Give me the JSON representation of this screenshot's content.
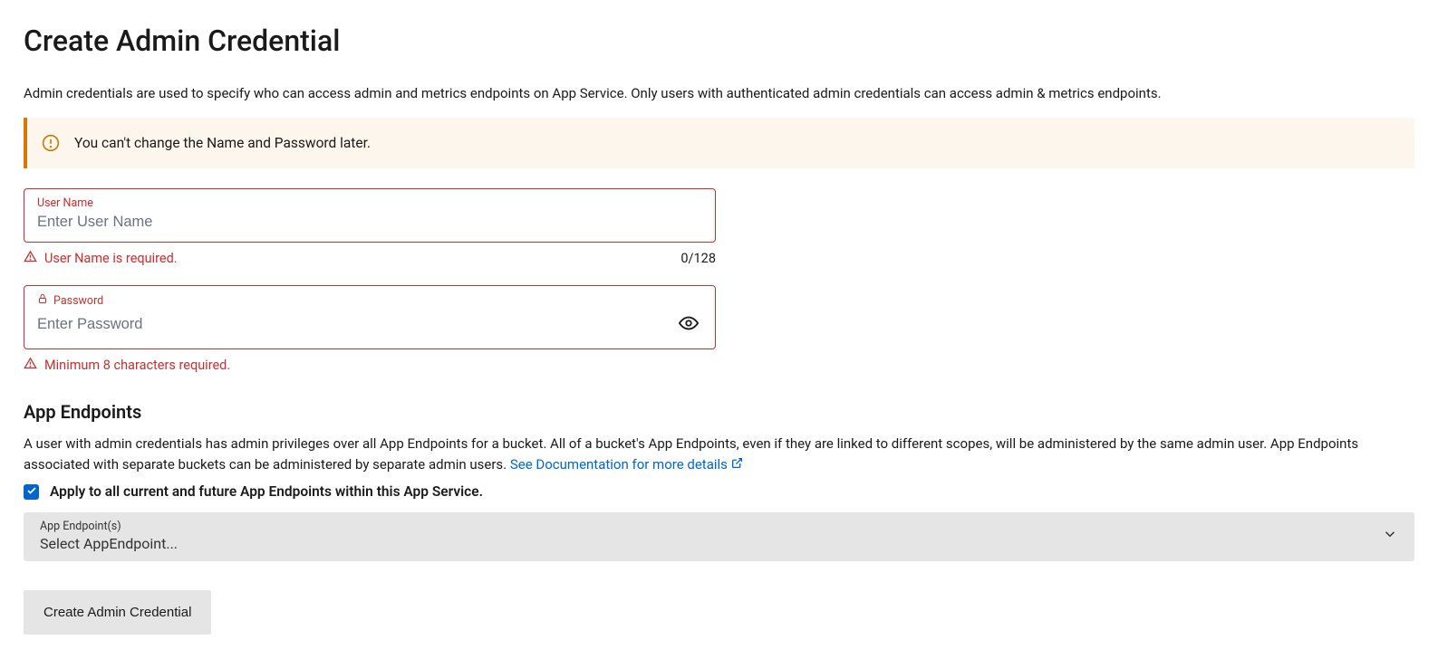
{
  "title": "Create Admin Credential",
  "intro": "Admin credentials are used to specify who can access admin and metrics endpoints on App Service. Only users with authenticated admin credentials can access admin & metrics endpoints.",
  "alert": {
    "text": "You can't change the Name and Password later."
  },
  "username": {
    "label": "User Name",
    "placeholder": "Enter User Name",
    "error": "User Name is required.",
    "counter": "0/128"
  },
  "password": {
    "label": "Password",
    "placeholder": "Enter Password",
    "error": "Minimum 8 characters required."
  },
  "endpoints": {
    "title": "App Endpoints",
    "desc": "A user with admin credentials has admin privileges over all App Endpoints for a bucket. All of a bucket's App Endpoints, even if they are linked to different scopes, will be administered by the same admin user. App Endpoints associated with separate buckets can be administered by separate admin users.",
    "doc_link": "See Documentation for more details",
    "apply_all_label": "Apply to all current and future App Endpoints within this App Service.",
    "apply_all_checked": true,
    "select_label": "App Endpoint(s)",
    "select_placeholder": "Select AppEndpoint..."
  },
  "submit_label": "Create Admin Credential"
}
